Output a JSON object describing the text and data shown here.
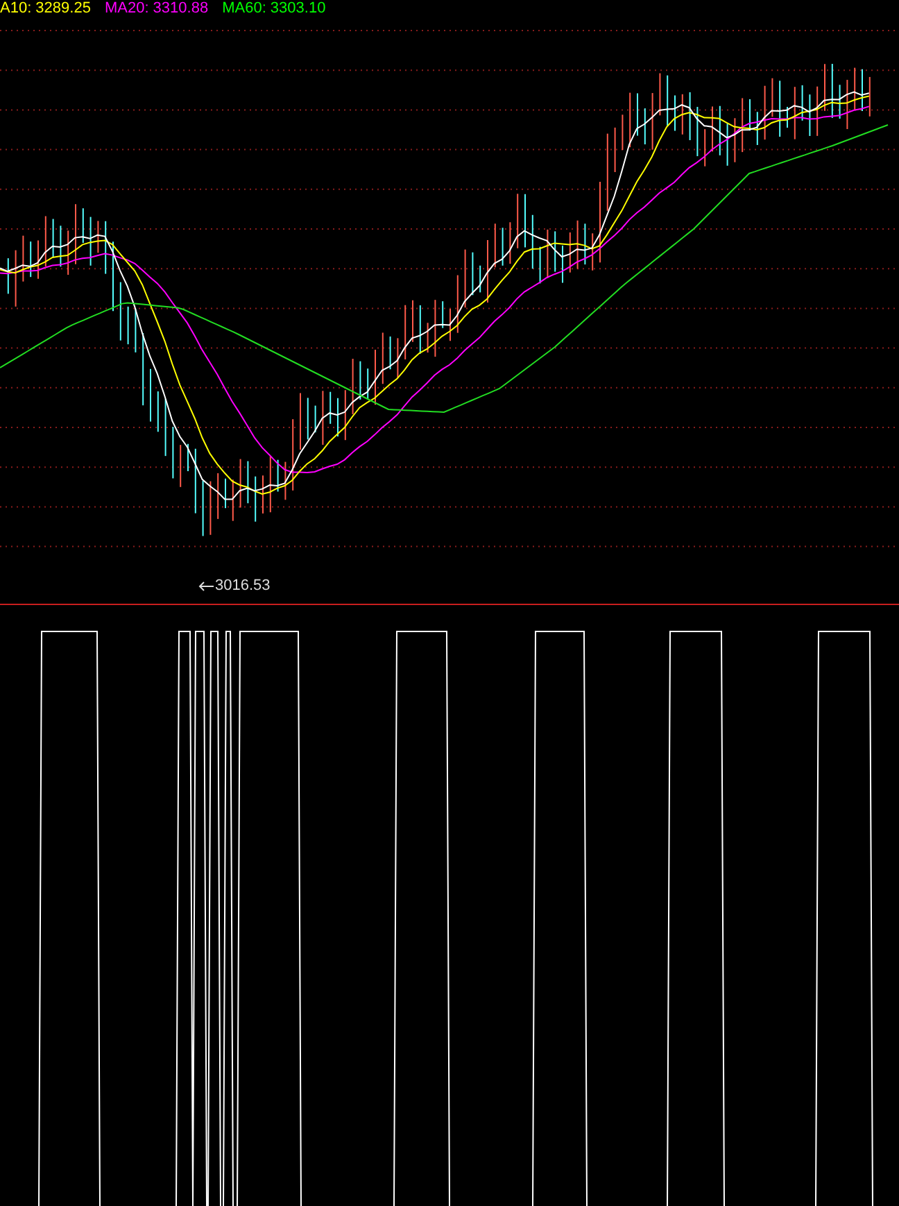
{
  "legend": [
    {
      "label": "A10: 3289.25",
      "color": "#ffff00"
    },
    {
      "label": "MA20: 3310.88",
      "color": "#ff00ff"
    },
    {
      "label": "MA60: 3303.10",
      "color": "#00ff00"
    }
  ],
  "price_panel": {
    "low_marker": "3016.53"
  }
}
